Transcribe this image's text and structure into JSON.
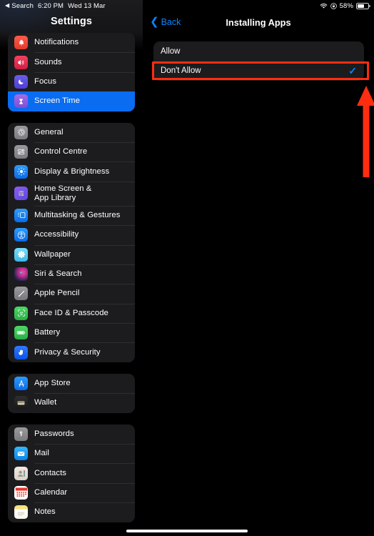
{
  "status_bar": {
    "back_app": "Search",
    "time": "6:20 PM",
    "date": "Wed 13 Mar",
    "battery_percent": "58%",
    "icons": [
      "wifi-icon",
      "rotation-lock-icon",
      "battery-icon"
    ]
  },
  "sidebar": {
    "title": "Settings",
    "groups": [
      {
        "items": [
          {
            "label": "Notifications",
            "icon": "bell-icon",
            "selected": false
          },
          {
            "label": "Sounds",
            "icon": "speaker-icon",
            "selected": false
          },
          {
            "label": "Focus",
            "icon": "moon-icon",
            "selected": false
          },
          {
            "label": "Screen Time",
            "icon": "hourglass-icon",
            "selected": true
          }
        ]
      },
      {
        "items": [
          {
            "label": "General",
            "icon": "gear-icon",
            "selected": false
          },
          {
            "label": "Control Centre",
            "icon": "sliders-icon",
            "selected": false
          },
          {
            "label": "Display & Brightness",
            "icon": "brightness-icon",
            "selected": false
          },
          {
            "label": "Home Screen &\nApp Library",
            "icon": "app-grid-icon",
            "selected": false
          },
          {
            "label": "Multitasking & Gestures",
            "icon": "multitasking-icon",
            "selected": false
          },
          {
            "label": "Accessibility",
            "icon": "accessibility-icon",
            "selected": false
          },
          {
            "label": "Wallpaper",
            "icon": "wallpaper-icon",
            "selected": false
          },
          {
            "label": "Siri & Search",
            "icon": "siri-icon",
            "selected": false
          },
          {
            "label": "Apple Pencil",
            "icon": "pencil-icon",
            "selected": false
          },
          {
            "label": "Face ID & Passcode",
            "icon": "face-id-icon",
            "selected": false
          },
          {
            "label": "Battery",
            "icon": "battery-icon",
            "selected": false
          },
          {
            "label": "Privacy & Security",
            "icon": "hand-icon",
            "selected": false
          }
        ]
      },
      {
        "items": [
          {
            "label": "App Store",
            "icon": "app-store-icon",
            "selected": false
          },
          {
            "label": "Wallet",
            "icon": "wallet-icon",
            "selected": false
          }
        ]
      },
      {
        "items": [
          {
            "label": "Passwords",
            "icon": "key-icon",
            "selected": false
          },
          {
            "label": "Mail",
            "icon": "mail-icon",
            "selected": false
          },
          {
            "label": "Contacts",
            "icon": "contacts-icon",
            "selected": false
          },
          {
            "label": "Calendar",
            "icon": "calendar-icon",
            "selected": false
          },
          {
            "label": "Notes",
            "icon": "notes-icon",
            "selected": false
          }
        ]
      }
    ]
  },
  "detail": {
    "back_label": "Back",
    "title": "Installing Apps",
    "options": [
      {
        "label": "Allow",
        "checked": false
      },
      {
        "label": "Don't Allow",
        "checked": true
      }
    ]
  },
  "annotations": {
    "highlight_color": "#FF2D10",
    "highlight_target": "Don't Allow",
    "arrow_direction": "up"
  },
  "colors": {
    "accent_blue": "#0A84FF",
    "selection_blue": "#0A6CF0",
    "card_background": "#1C1C1E",
    "page_background": "#000000"
  }
}
